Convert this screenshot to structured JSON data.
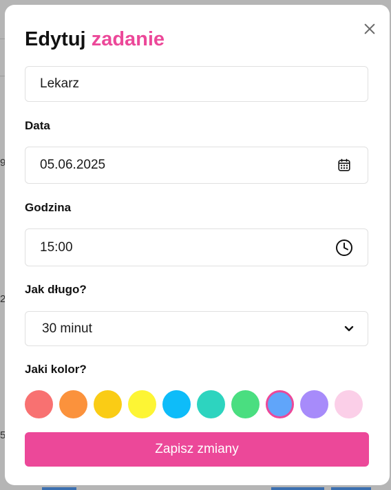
{
  "background": {
    "digits": [
      "9",
      "2",
      "5"
    ]
  },
  "dialog": {
    "title_prefix": "Edytuj",
    "title_accent": "zadanie",
    "name_value": "Lekarz",
    "date_label": "Data",
    "date_value": "05.06.2025",
    "time_label": "Godzina",
    "time_value": "15:00",
    "duration_label": "Jak długo?",
    "duration_value": "30 minut",
    "color_label": "Jaki kolor?",
    "colors": [
      "#f87171",
      "#fb923c",
      "#facc15",
      "#fdf534",
      "#0ebcf9",
      "#2dd4bf",
      "#4ade80",
      "#60a5fa",
      "#a78bfa",
      "#fbcfe8"
    ],
    "selected_color_index": 7,
    "submit_label": "Zapisz zmiany",
    "accent_color": "#ec4899",
    "close_icon": "close-icon",
    "date_icon": "calendar-icon",
    "time_icon": "clock-icon",
    "select_icon": "chevron-down-icon"
  }
}
